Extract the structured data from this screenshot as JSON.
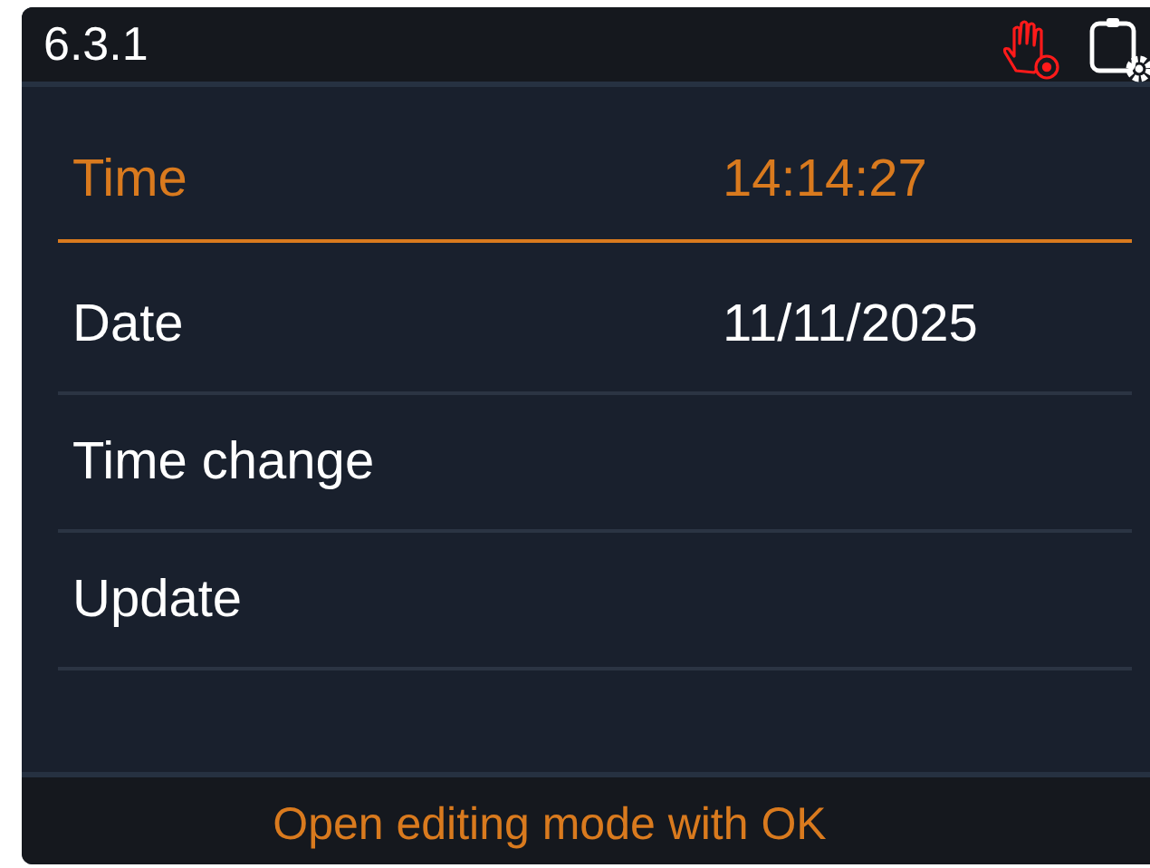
{
  "header": {
    "title": "6.3.1"
  },
  "menu": [
    {
      "label": "Time",
      "value": "14:14:27",
      "selected": true
    },
    {
      "label": "Date",
      "value": "11/11/2025",
      "selected": false
    },
    {
      "label": "Time change",
      "selected": false
    },
    {
      "label": "Update",
      "selected": false
    }
  ],
  "footer": {
    "hint": "Open editing mode with OK"
  }
}
